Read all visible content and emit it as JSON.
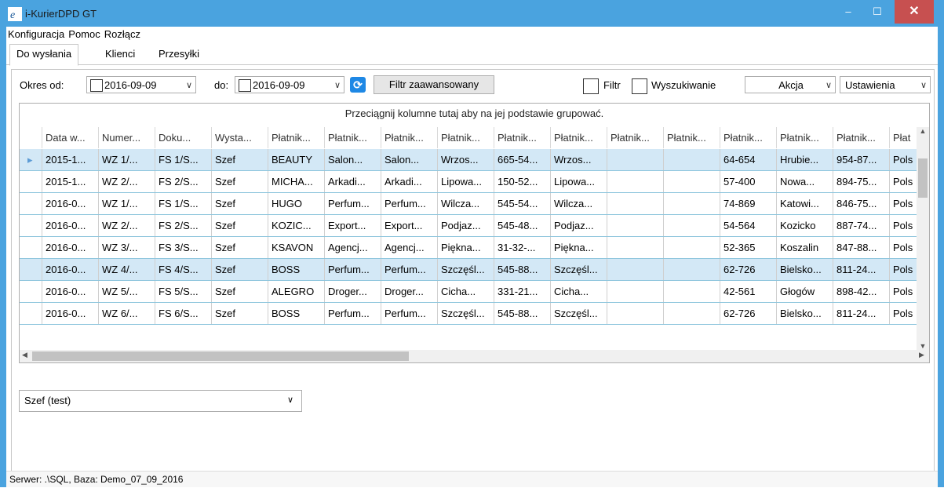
{
  "window": {
    "title": "i-KurierDPD GT",
    "min": "–",
    "max": "☐",
    "close": "✕"
  },
  "menu": [
    "Konfiguracja",
    "Pomoc",
    "Rozłącz"
  ],
  "tabs": [
    "Do wysłania",
    "Klienci",
    "Przesyłki"
  ],
  "toolbar": {
    "okres_label": "Okres od:",
    "from_date": "2016-09-09",
    "do_label": "do:",
    "to_date": "2016-09-09",
    "filter_adv": "Filtr zaawansowany",
    "filtr": "Filtr",
    "search": "Wyszukiwanie",
    "akcja": "Akcja",
    "ustawienia": "Ustawienia"
  },
  "grid": {
    "group_hint": "Przeciągnij kolumne tutaj aby na jej podstawie grupować.",
    "columns": [
      "Data w...",
      "Numer...",
      "Doku...",
      "Wysta...",
      "Płatnik...",
      "Płatnik...",
      "Płatnik...",
      "Płatnik...",
      "Płatnik...",
      "Płatnik...",
      "Płatnik...",
      "Płatnik...",
      "Płatnik...",
      "Płatnik...",
      "Płatnik...",
      "Płat"
    ],
    "rows": [
      [
        "2015-1...",
        "WZ 1/...",
        "FS 1/S...",
        "Szef",
        "BEAUTY",
        "Salon...",
        "Salon...",
        "Wrzos...",
        "665-54...",
        "Wrzos...",
        "",
        "",
        "64-654",
        "Hrubie...",
        "954-87...",
        "Pols"
      ],
      [
        "2015-1...",
        "WZ 2/...",
        "FS 2/S...",
        "Szef",
        "MICHA...",
        "Arkadi...",
        "Arkadi...",
        "Lipowa...",
        "150-52...",
        "Lipowa...",
        "",
        "",
        "57-400",
        "Nowa...",
        "894-75...",
        "Pols"
      ],
      [
        "2016-0...",
        "WZ 1/...",
        "FS 1/S...",
        "Szef",
        "HUGO",
        "Perfum...",
        "Perfum...",
        "Wilcza...",
        "545-54...",
        "Wilcza...",
        "",
        "",
        "74-869",
        "Katowi...",
        "846-75...",
        "Pols"
      ],
      [
        "2016-0...",
        "WZ 2/...",
        "FS 2/S...",
        "Szef",
        "KOZIC...",
        "Export...",
        "Export...",
        "Podjaz...",
        "545-48...",
        "Podjaz...",
        "",
        "",
        "54-564",
        "Kozicko",
        "887-74...",
        "Pols"
      ],
      [
        "2016-0...",
        "WZ 3/...",
        "FS 3/S...",
        "Szef",
        "KSAVON",
        "Agencj...",
        "Agencj...",
        "Piękna...",
        "31-32-...",
        "Piękna...",
        "",
        "",
        "52-365",
        "Koszalin",
        "847-88...",
        "Pols"
      ],
      [
        "2016-0...",
        "WZ 4/...",
        "FS 4/S...",
        "Szef",
        "BOSS",
        "Perfum...",
        "Perfum...",
        "Szczęśl...",
        "545-88...",
        "Szczęśl...",
        "",
        "",
        "62-726",
        "Bielsko...",
        "811-24...",
        "Pols"
      ],
      [
        "2016-0...",
        "WZ 5/...",
        "FS 5/S...",
        "Szef",
        "ALEGRO",
        "Droger...",
        "Droger...",
        "Cicha...",
        "331-21...",
        "Cicha...",
        "",
        "",
        "42-561",
        "Głogów",
        "898-42...",
        "Pols"
      ],
      [
        "2016-0...",
        "WZ 6/...",
        "FS 6/S...",
        "Szef",
        "BOSS",
        "Perfum...",
        "Perfum...",
        "Szczęśl...",
        "545-88...",
        "Szczęśl...",
        "",
        "",
        "62-726",
        "Bielsko...",
        "811-24...",
        "Pols"
      ]
    ]
  },
  "user_select": "Szef (test)",
  "status": "Serwer: .\\SQL, Baza: Demo_07_09_2016"
}
